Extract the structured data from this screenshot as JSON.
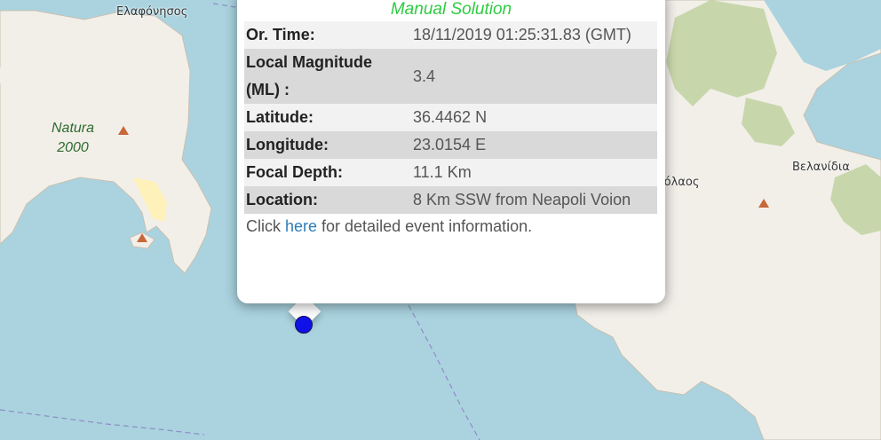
{
  "map": {
    "labels": {
      "elafonisos": "Ελαφόνησος",
      "natura": "Natura\n2000",
      "velanidia": "Βελανίδια",
      "agios_nikolaos": "κόλαος"
    }
  },
  "popup": {
    "title": "Manual Solution",
    "rows": [
      {
        "label": "Or. Time:",
        "value": "18/11/2019 01:25:31.83 (GMT)"
      },
      {
        "label": "Local Magnitude (ML) :",
        "value": "3.4"
      },
      {
        "label": "Latitude:",
        "value": "36.4462 N"
      },
      {
        "label": "Longitude:",
        "value": "23.0154 E"
      },
      {
        "label": "Focal Depth:",
        "value": "11.1 Km"
      },
      {
        "label": "Location:",
        "value": "8 Km SSW from Neapoli Voion"
      }
    ],
    "footer": {
      "prefix": "Click ",
      "link": "here",
      "suffix": " for detailed event information."
    }
  },
  "colors": {
    "sea": "#aad3df",
    "land": "#f2efe9",
    "forest": "#c8d7ab",
    "title": "#2ecc40",
    "link": "#2e7db8",
    "marker": "#1010e8"
  }
}
